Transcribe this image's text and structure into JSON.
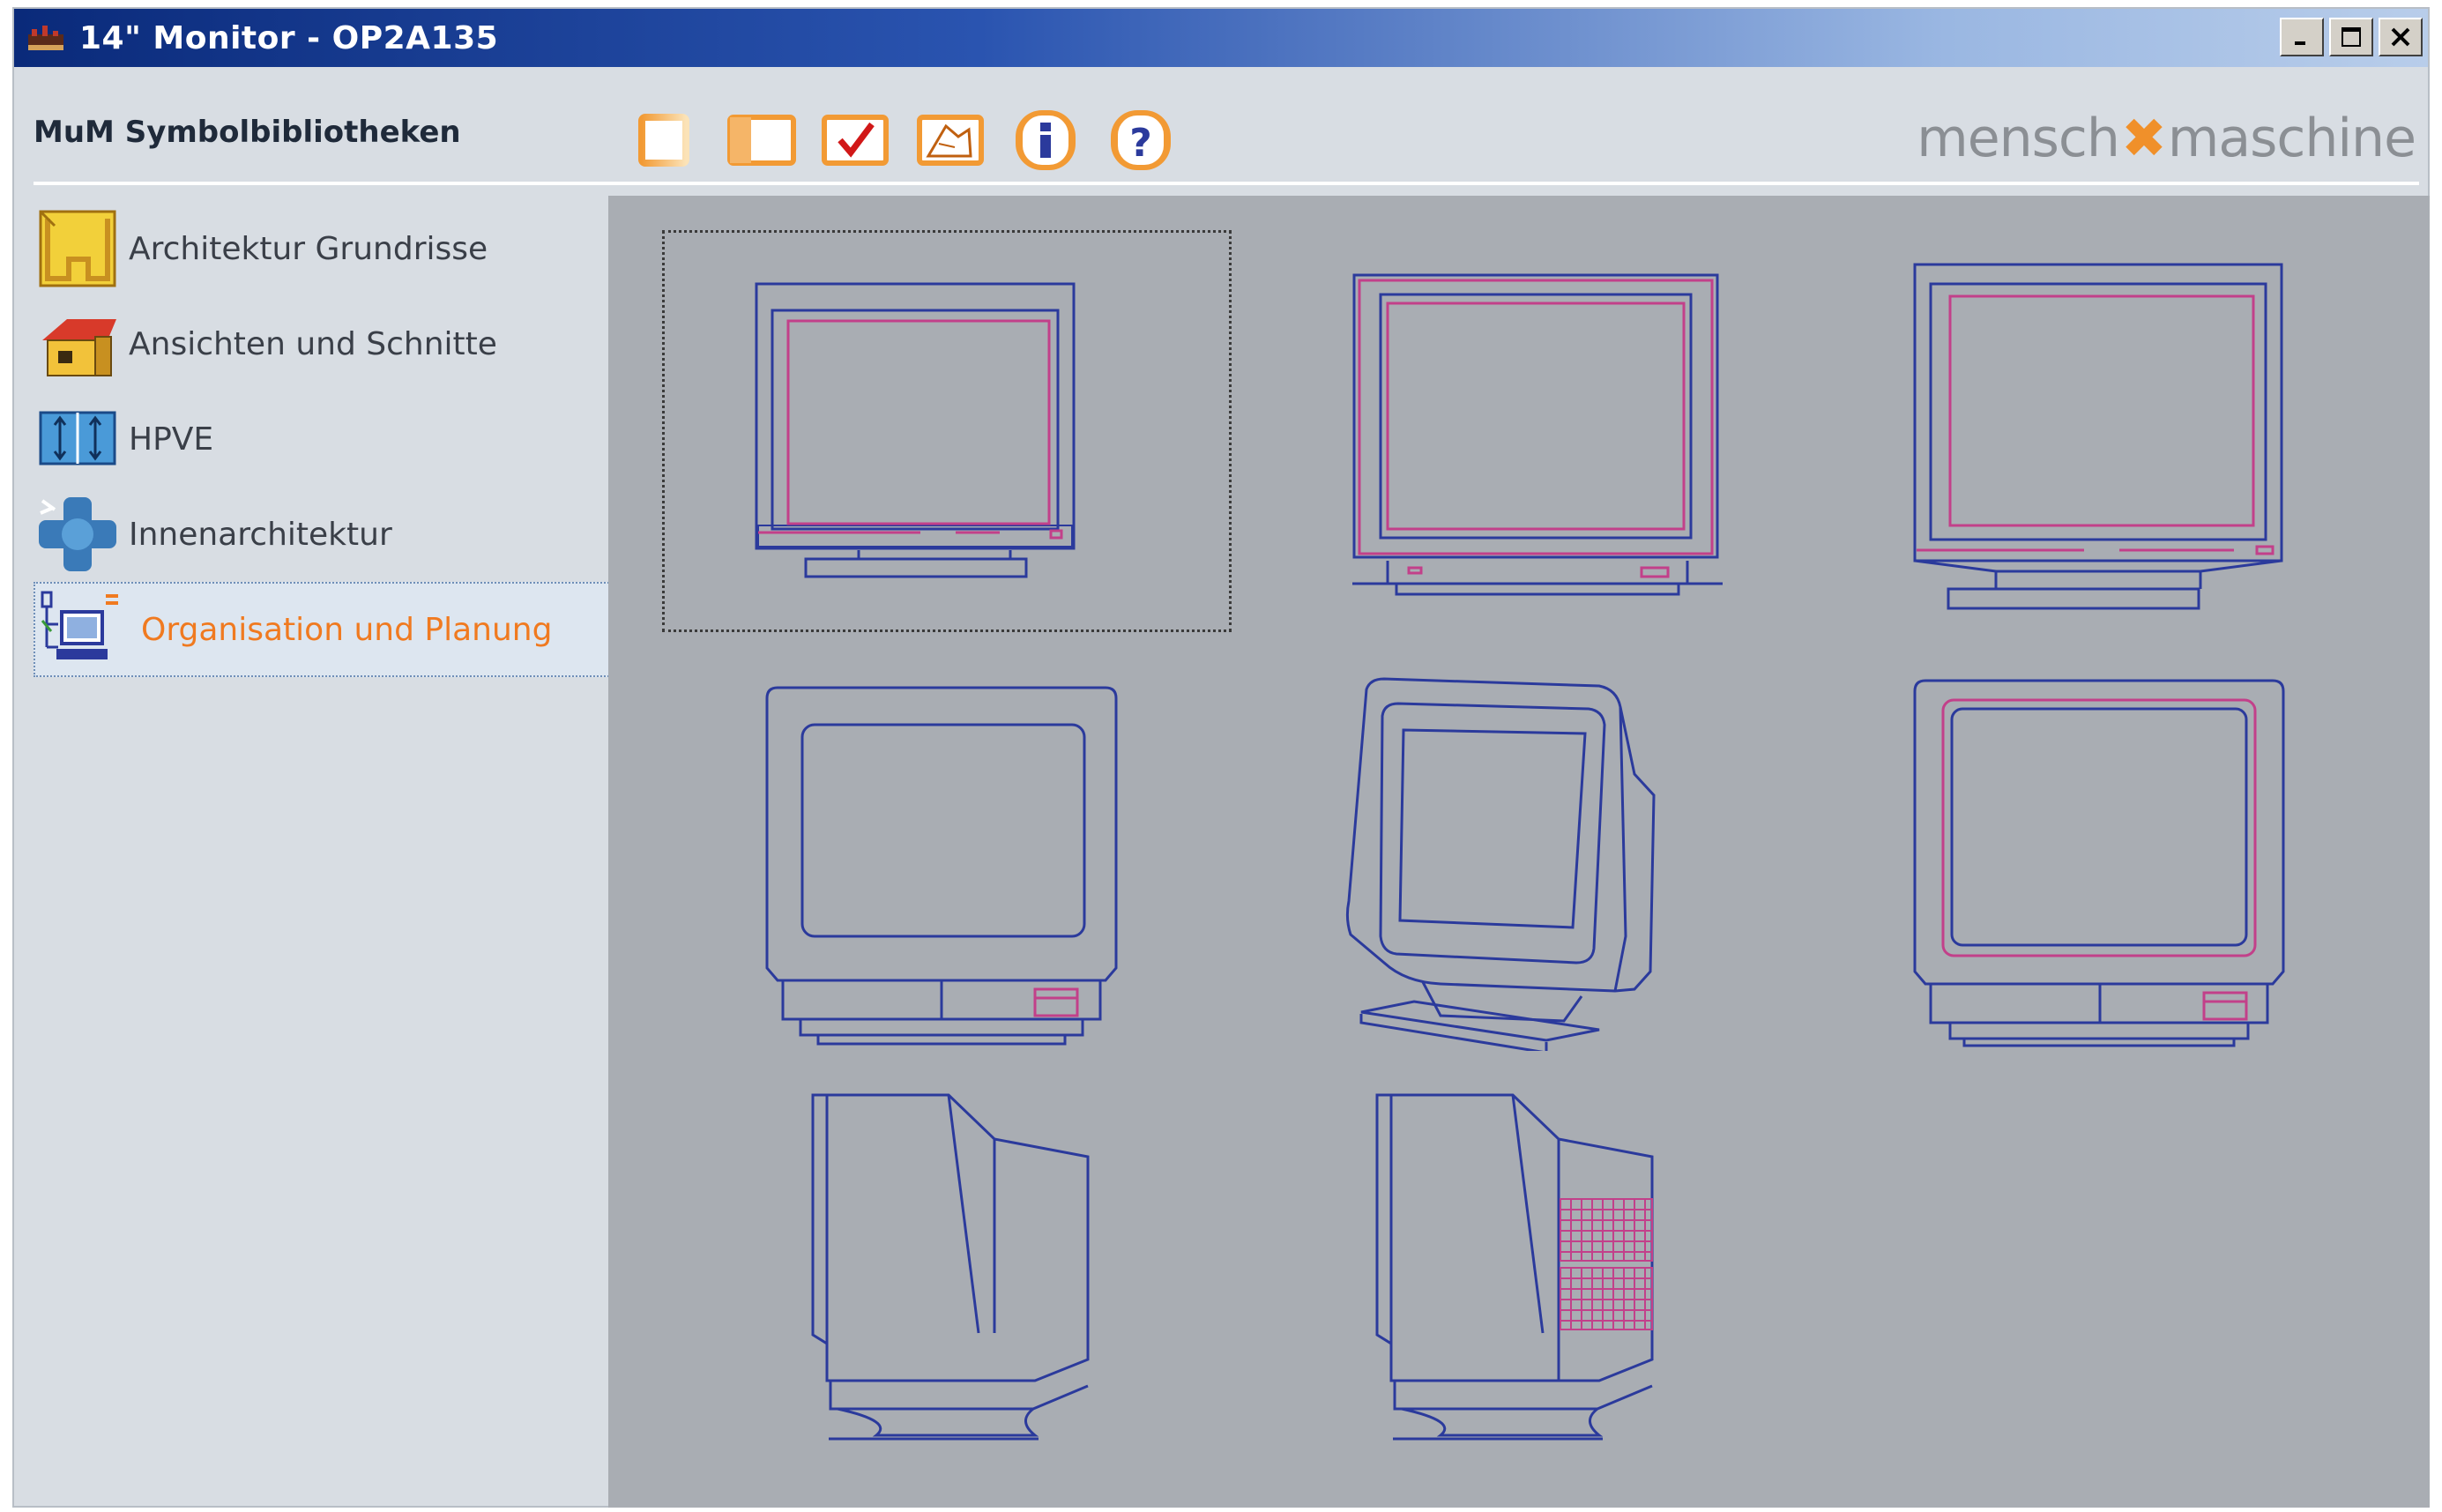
{
  "window": {
    "title": "14\" Monitor - OP2A135",
    "controls": [
      "minimize",
      "maximize",
      "close"
    ]
  },
  "toolbar": {
    "app_label": "MuM Symbolbibliotheken",
    "buttons": [
      {
        "name": "single-view-icon"
      },
      {
        "name": "split-view-icon"
      },
      {
        "name": "checkmark-icon"
      },
      {
        "name": "scale-icon"
      },
      {
        "name": "info-icon"
      },
      {
        "name": "help-icon"
      }
    ],
    "brand_left": "mensch",
    "brand_right": "maschine",
    "brand_accent_color": "#f0902a"
  },
  "sidebar": {
    "items": [
      {
        "label": "Architektur Grundrisse",
        "icon": "floorplan-icon",
        "selected": false
      },
      {
        "label": "Ansichten und Schnitte",
        "icon": "house-icon",
        "selected": false
      },
      {
        "label": "HPVE",
        "icon": "hpve-icon",
        "selected": false
      },
      {
        "label": "Innenarchitektur",
        "icon": "interior-icon",
        "selected": false
      },
      {
        "label": "Organisation und Planung",
        "icon": "office-icon",
        "selected": true
      }
    ],
    "selected_color": "#f07a20"
  },
  "gallery": {
    "symbols": [
      {
        "name": "monitor-front-1",
        "focused": true
      },
      {
        "name": "monitor-front-2",
        "focused": false
      },
      {
        "name": "monitor-front-3",
        "focused": false
      },
      {
        "name": "monitor-front-4",
        "focused": false
      },
      {
        "name": "monitor-perspective",
        "focused": false
      },
      {
        "name": "monitor-front-5",
        "focused": false
      },
      {
        "name": "monitor-side-1",
        "focused": false
      },
      {
        "name": "monitor-side-2",
        "focused": false
      }
    ],
    "line_color": "#2b3a9c",
    "accent_line_color": "#c2408a"
  }
}
